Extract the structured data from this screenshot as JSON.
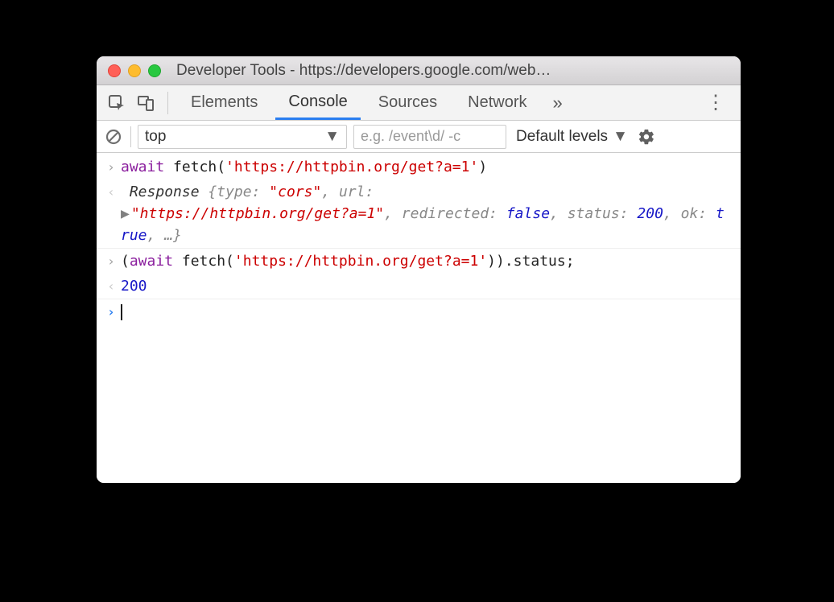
{
  "window": {
    "title": "Developer Tools - https://developers.google.com/web…"
  },
  "tabs": {
    "elements": "Elements",
    "console": "Console",
    "sources": "Sources",
    "network": "Network",
    "more": "»"
  },
  "toolbar": {
    "context": "top",
    "filter_placeholder": "e.g. /event\\d/ -c",
    "levels_label": "Default levels"
  },
  "console": {
    "entry1": {
      "await": "await",
      "fn": " fetch(",
      "arg": "'https://httpbin.org/get?a=1'",
      "close": ")"
    },
    "result1": {
      "objName": "Response ",
      "brace_open": "{",
      "type_k": "type: ",
      "type_v": "\"cors\"",
      "url_k": ", url: ",
      "url_v": "\"https://httpbin.org/get?a=1\"",
      "redirected_k": ", redirected: ",
      "redirected_v": "false",
      "status_k": ", status: ",
      "status_v": "200",
      "ok_k": ", ok: ",
      "ok_v": "true",
      "tail": ", …}"
    },
    "entry2": {
      "open": "(",
      "await": "await",
      "fn": " fetch(",
      "arg": "'https://httpbin.org/get?a=1'",
      "close": ")).status;"
    },
    "result2": "200"
  }
}
